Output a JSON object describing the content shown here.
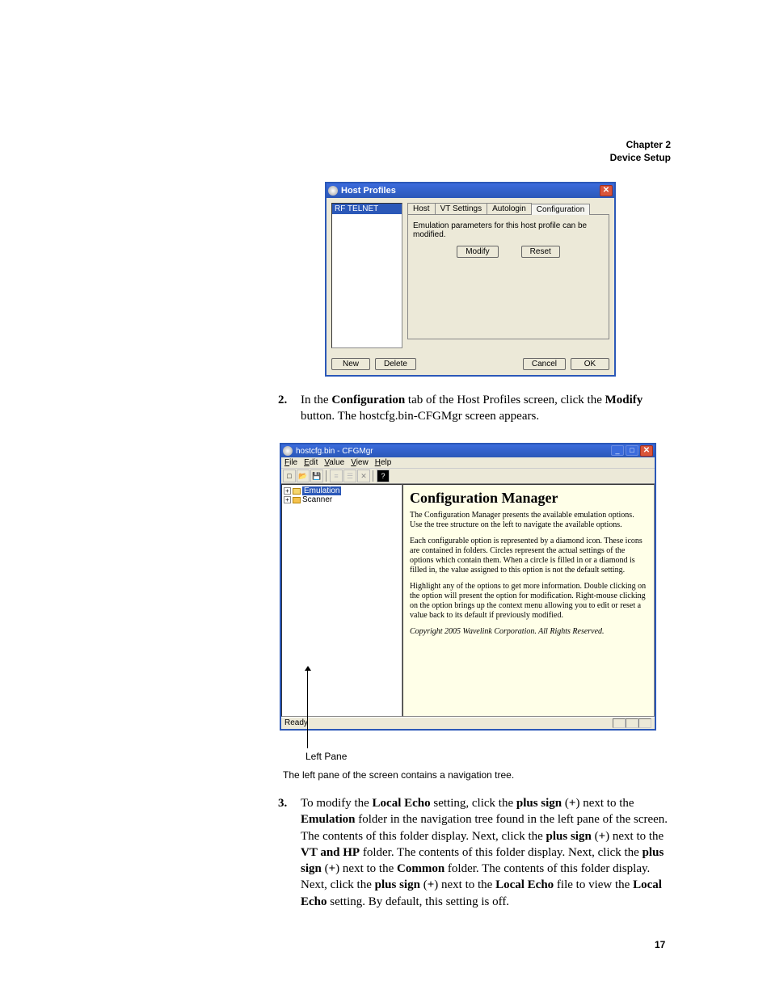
{
  "header": {
    "chapter": "Chapter 2",
    "title": "Device Setup"
  },
  "host_profiles": {
    "window_title": "Host Profiles",
    "list_item": "RF TELNET",
    "tabs": [
      "Host",
      "VT Settings",
      "Autologin",
      "Configuration"
    ],
    "active_tab_index": 3,
    "message": "Emulation parameters for this host profile can be modified.",
    "modify_btn": "Modify",
    "reset_btn": "Reset",
    "new_btn": "New",
    "delete_btn": "Delete",
    "cancel_btn": "Cancel",
    "ok_btn": "OK"
  },
  "step2": {
    "num": "2.",
    "text_parts": {
      "p1": "In the ",
      "b1": "Configuration",
      "p2": " tab of the Host Profiles screen, click the ",
      "b2": "Modify",
      "p3": " button. The hostcfg.bin-CFGMgr screen appears."
    }
  },
  "cfg": {
    "window_title": "hostcfg.bin - CFGMgr",
    "menus": [
      "File",
      "Edit",
      "Value",
      "View",
      "Help"
    ],
    "tree": {
      "item1": "Emulation",
      "item2": "Scanner"
    },
    "content_title": "Configuration Manager",
    "p1": "The Configuration Manager presents the available emulation options. Use the tree structure on the left to navigate the available options.",
    "p2": "Each configurable option is represented by a diamond icon. These icons are contained in folders. Circles represent the actual settings of the options which contain them. When a circle is filled in or a diamond is filled in, the value assigned to this option is not the default setting.",
    "p3": "Highlight any of the options to get more information. Double clicking on the option will present the option for modification. Right-mouse clicking on the option brings up the context menu allowing you to edit or reset a value back to its default if previously modified.",
    "copyright": "Copyright 2005 Wavelink Corporation. All Rights Reserved.",
    "status": "Ready"
  },
  "leftpane_label": "Left Pane",
  "caption": "The left pane of the screen contains a navigation tree.",
  "step3": {
    "num": "3.",
    "text_parts": {
      "p1": "To modify the ",
      "b1": "Local Echo",
      "p2": " setting, click the ",
      "b2": "plus sign",
      "p3": " (",
      "b3": "+",
      "p4": ") next to the ",
      "b4": "Emulation",
      "p5": " folder in the navigation tree found in the left pane of the screen. The contents of this folder display. Next, click the ",
      "b5": "plus sign",
      "p6": " (",
      "b6": "+",
      "p7": ") next to the ",
      "b7": "VT and HP",
      "p8": " folder. The contents of this folder display. Next, click the ",
      "b8": "plus sign",
      "p9": " (",
      "b9": "+",
      "p10": ") next to the ",
      "b10": "Common",
      "p11": " folder. The contents of this folder display. Next, click the ",
      "b11": "plus sign",
      "p12": " (",
      "b12": "+",
      "p13": ") next to the ",
      "b13": "Local Echo",
      "p14": " file to view the ",
      "b14": "Local Echo",
      "p15": " setting. By default, this setting is off."
    }
  },
  "page_number": "17"
}
